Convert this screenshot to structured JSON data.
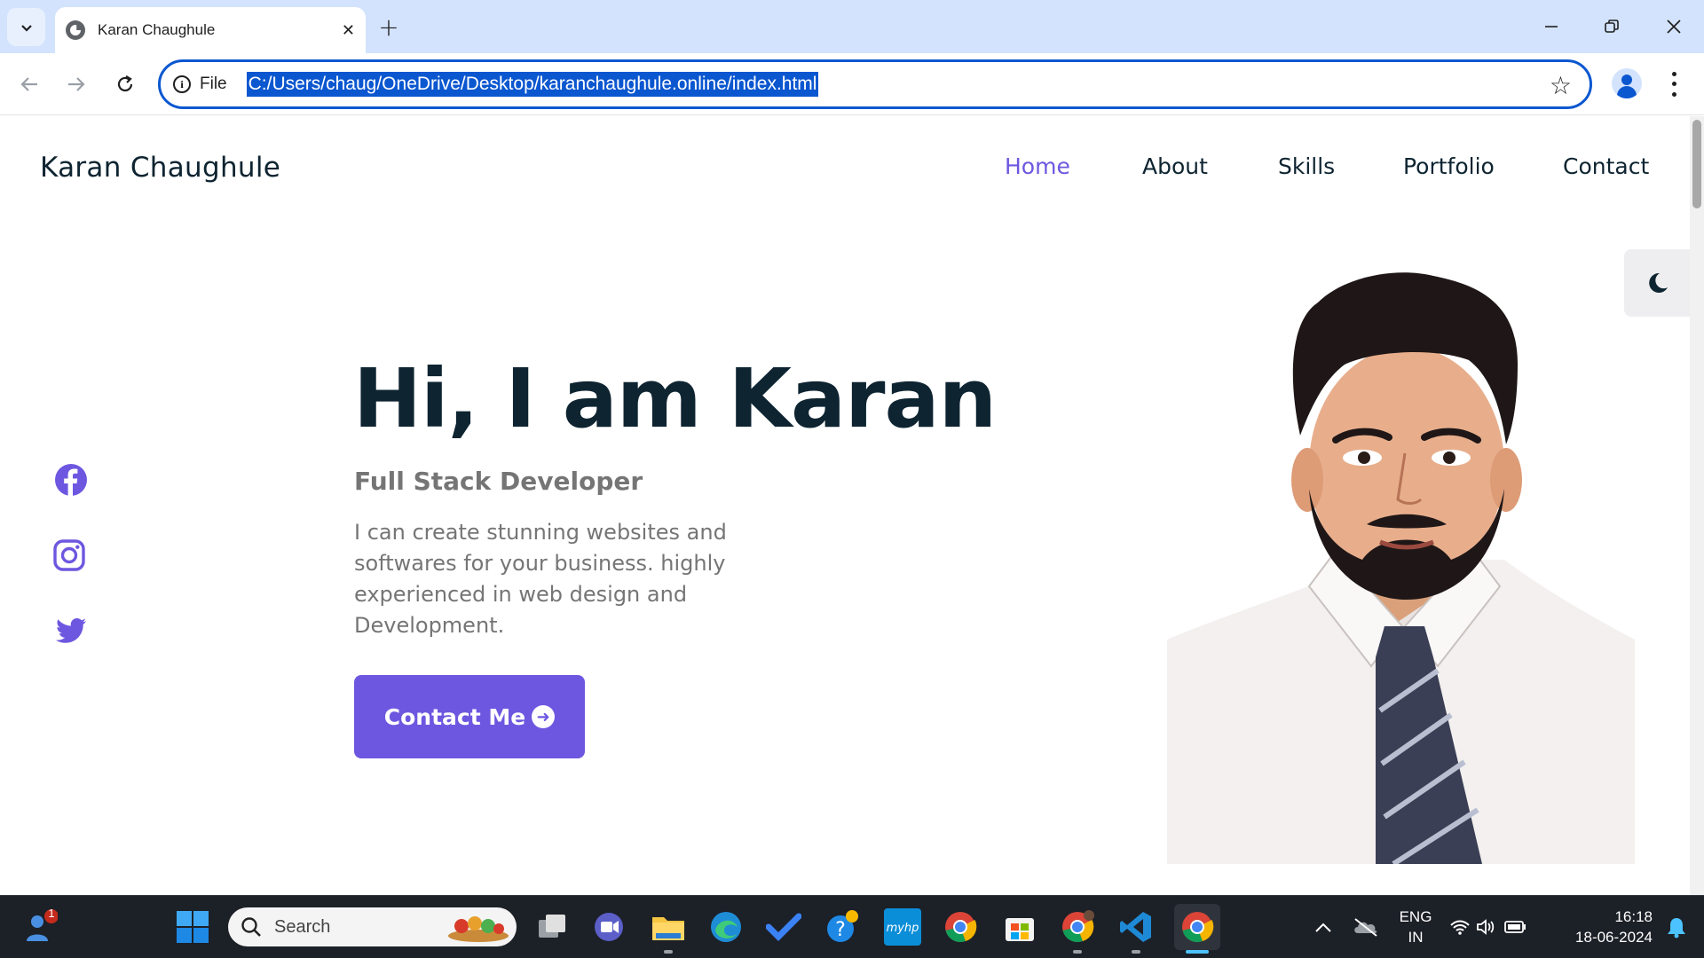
{
  "browser": {
    "tab_title": "Karan Chaughule",
    "file_chip": "File",
    "url": "C:/Users/chaug/OneDrive/Desktop/karanchaughule.online/index.html"
  },
  "site": {
    "logo": "Karan Chaughule",
    "nav": [
      "Home",
      "About",
      "Skills",
      "Portfolio",
      "Contact"
    ],
    "active_nav": "Home",
    "hero": {
      "title": "Hi, I am Karan",
      "subtitle": "Full Stack Developer",
      "description": "I can create stunning websites and softwares for your business. highly experienced in web design and Development.",
      "cta": "Contact Me"
    },
    "socials": [
      "facebook-icon",
      "instagram-icon",
      "twitter-icon"
    ],
    "accent_color": "#6e57e0",
    "text_color": "#0e2431"
  },
  "taskbar": {
    "search_label": "Search",
    "notification_badge": "1",
    "lang_line1": "ENG",
    "lang_line2": "IN",
    "time": "16:18",
    "date": "18-06-2024"
  }
}
